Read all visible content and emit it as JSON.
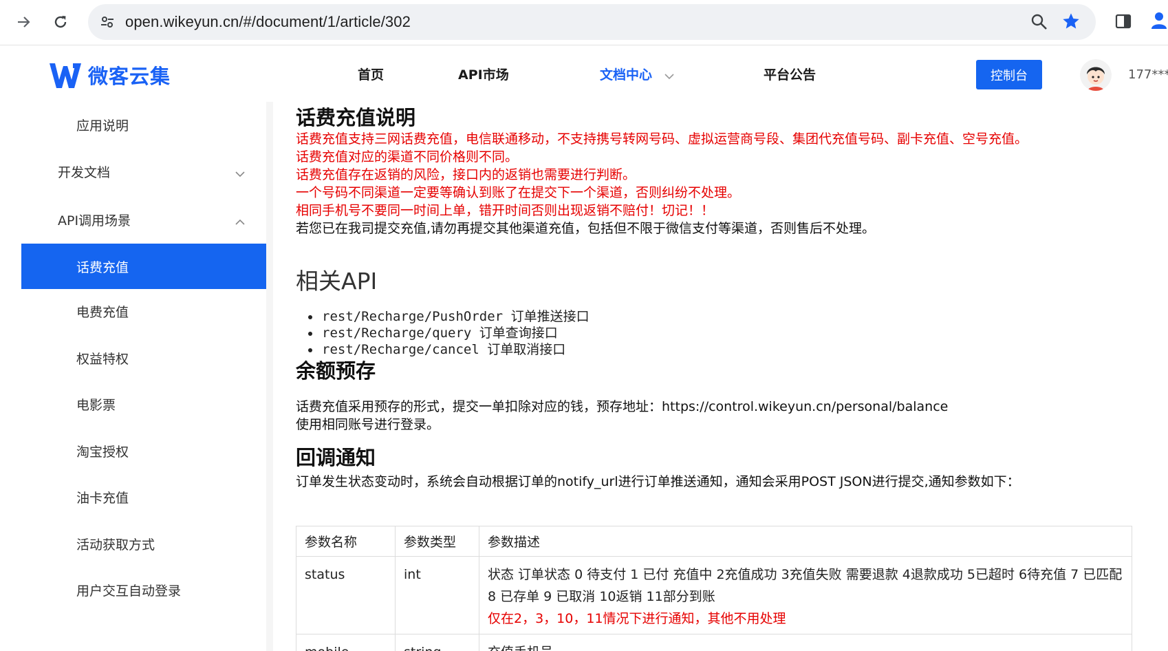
{
  "browser": {
    "url": "open.wikeyun.cn/#/document/1/article/302",
    "icons": [
      "back-arrow-icon",
      "reload-icon",
      "site-info-icon",
      "zoom-icon",
      "bookmark-star-icon",
      "side-panel-icon",
      "profile-icon"
    ],
    "star_color": "#1a62f5"
  },
  "header": {
    "logo_text": "微客云集",
    "nav": [
      {
        "label": "首页"
      },
      {
        "label": "API市场"
      },
      {
        "label": "文档中心"
      },
      {
        "label": "平台公告"
      }
    ],
    "console_label": "控制台",
    "username": "177****",
    "accent_color": "#1565f0"
  },
  "sidebar": {
    "items": [
      {
        "label": "应用说明"
      },
      {
        "label": "开发文档"
      },
      {
        "label": "API调用场景"
      },
      {
        "label": "话费充值"
      },
      {
        "label": "电费充值"
      },
      {
        "label": "权益特权"
      },
      {
        "label": "电影票"
      },
      {
        "label": "淘宝授权"
      },
      {
        "label": "油卡充值"
      },
      {
        "label": "活动获取方式"
      },
      {
        "label": "用户交互自动登录"
      }
    ]
  },
  "content": {
    "title": "话费充值说明",
    "notes_red": [
      "话费充值支持三网话费充值，电信联通移动，不支持携号转网号码、虚拟运营商号段、集团代充值号码、副卡充值、空号充值。",
      "话费充值对应的渠道不同价格则不同。",
      "话费充值存在返销的风险，接口内的返销也需要进行判断。",
      "一个号码不同渠道一定要等确认到账了在提交下一个渠道，否则纠纷不处理。",
      "相同手机号不要同一时间上单，错开时间否则出现返销不赔付！切记！！"
    ],
    "note_black": "若您已在我司提交充值,请勿再提交其他渠道充值，包括但不限于微信支付等渠道，否则售后不处理。",
    "related_api_title": "相关API",
    "apis": [
      {
        "path": "rest/Recharge/PushOrder",
        "desc": "订单推送接口"
      },
      {
        "path": "rest/Recharge/query",
        "desc": "订单查询接口"
      },
      {
        "path": "rest/Recharge/cancel",
        "desc": "订单取消接口"
      }
    ],
    "balance_title": "余额预存",
    "balance_line1": "话费充值采用预存的形式，提交一单扣除对应的钱，预存地址：https://control.wikeyun.cn/personal/balance",
    "balance_line2": "使用相同账号进行登录。",
    "callback_title": "回调通知",
    "callback_desc": "订单发生状态变动时，系统会自动根据订单的notify_url进行订单推送通知，通知会采用POST JSON进行提交,通知参数如下：",
    "table": {
      "headers": [
        "参数名称",
        "参数类型",
        "参数描述"
      ],
      "rows": [
        {
          "name": "status",
          "type": "int",
          "desc": "状态 订单状态 0 待支付 1 已付 充值中 2充值成功 3充值失败 需要退款 4退款成功 5已超时 6待充值 7 已匹配 8 已存单 9 已取消 10返销 11部分到账",
          "desc_red": "仅在2，3，10，11情况下进行通知，其他不用处理"
        },
        {
          "name": "mobile",
          "type": "string",
          "desc": "充值手机号",
          "desc_red": ""
        }
      ]
    }
  }
}
